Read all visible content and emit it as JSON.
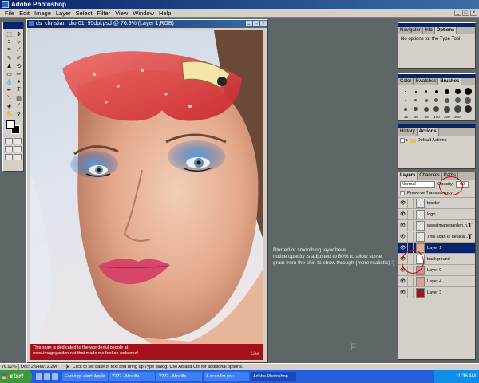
{
  "app": {
    "title": "Adobe Photoshop"
  },
  "menu": [
    "File",
    "Edit",
    "Image",
    "Layer",
    "Select",
    "Filter",
    "View",
    "Window",
    "Help"
  ],
  "document": {
    "title": "ds_christian_dior01_95dpi.psd @ 76.9% (Layer 1,RGB)",
    "caption_line1": "This scan is dedicated to the wonderful people at",
    "caption_line2": "www.imagegarden.net that made me feel so welcome!"
  },
  "annotation": {
    "line1": "Blurred or smoothing layer here",
    "line2": "notice opacity is adjusted to 60% to allow some",
    "line3": "grain from the skin to show through (more realistic) :)"
  },
  "watermark_letter": "F",
  "navigator_panel": {
    "tabs": [
      "Navigator",
      "Info",
      "Options"
    ],
    "message": "No options for the Type Tool"
  },
  "brushes_panel": {
    "tabs": [
      "Color",
      "Swatches",
      "Brushes"
    ],
    "numbers": [
      "35",
      "45",
      "65",
      "100",
      "200",
      "300"
    ]
  },
  "history_panel": {
    "tabs": [
      "History",
      "Actions"
    ],
    "item": "Default Actions"
  },
  "layers_panel": {
    "tabs": [
      "Layers",
      "Channels",
      "Paths"
    ],
    "blend_mode": "Normal",
    "opacity_label": "Opacity:",
    "opacity_value": "60",
    "preserve_label": "Preserve Transparency",
    "layers": [
      {
        "name": "border",
        "type": "raster"
      },
      {
        "name": "logo",
        "type": "raster"
      },
      {
        "name": "www.imagegarden.n...",
        "type": "text"
      },
      {
        "name": "This scan is dedicat...",
        "type": "text"
      },
      {
        "name": "Layer 1",
        "type": "raster",
        "selected": true
      },
      {
        "name": "background",
        "type": "raster"
      },
      {
        "name": "Layer 0",
        "type": "raster"
      },
      {
        "name": "Layer 4",
        "type": "raster"
      },
      {
        "name": "Layer 3",
        "type": "raster"
      }
    ]
  },
  "status": {
    "zoom": "76.92%",
    "doc": "Doc: 2.64M/72.2M",
    "hint": "Click to set base of text and bring up Type dialog. Use Alt and Ctrl for additional options."
  },
  "taskbar": {
    "start": "start",
    "items": [
      "Earnings alert: Apple ...",
      "???? - Mozilla",
      "???? - Mozilla",
      "A scan for you ...",
      "Adobe Photoshop"
    ],
    "clock": "11:36 AM"
  },
  "colors": {
    "title_blue": "#0a246a",
    "caption_red": "#a4111d",
    "annotation_circle": "#c80a0a"
  }
}
